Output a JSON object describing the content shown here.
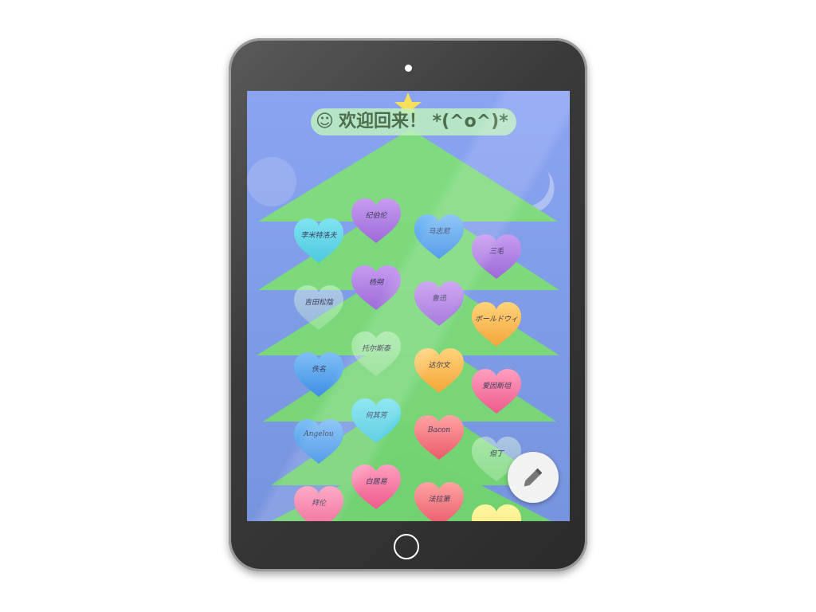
{
  "app": {
    "greeting": "欢迎回来！ *(^o^)*",
    "colors": {
      "sky": "#8aa4f2",
      "tree": "#7ed67e",
      "star": "#f7df5a",
      "bezel": "#3a3a3a"
    },
    "icons": {
      "greeting": "smiley-icon",
      "fab": "pencil-icon"
    }
  },
  "hearts": [
    {
      "name": "李米特洛夫",
      "color": "cyan"
    },
    {
      "name": "纪伯伦",
      "color": "purple"
    },
    {
      "name": "马志尼",
      "color": "blue"
    },
    {
      "name": "三毛",
      "color": "purple"
    },
    {
      "name": "吉田松陰",
      "color": "ghost"
    },
    {
      "name": "杨朔",
      "color": "purple"
    },
    {
      "name": "鲁迅",
      "color": "purple"
    },
    {
      "name": "ボールドウィン",
      "color": "orange"
    },
    {
      "name": "托尔斯泰",
      "color": "ghost"
    },
    {
      "name": "佚名",
      "color": "blue"
    },
    {
      "name": "达尔文",
      "color": "orange"
    },
    {
      "name": "爱因斯坦",
      "color": "pink"
    },
    {
      "name": "何其芳",
      "color": "cyan"
    },
    {
      "name": "Angelou",
      "color": "blue"
    },
    {
      "name": "Bacon",
      "color": "red"
    },
    {
      "name": "但丁",
      "color": "ghost"
    },
    {
      "name": "白居易",
      "color": "pink"
    },
    {
      "name": "拜伦",
      "color": "pink"
    },
    {
      "name": "法拉第",
      "color": "red"
    },
    {
      "name": "",
      "color": "yellow"
    }
  ]
}
